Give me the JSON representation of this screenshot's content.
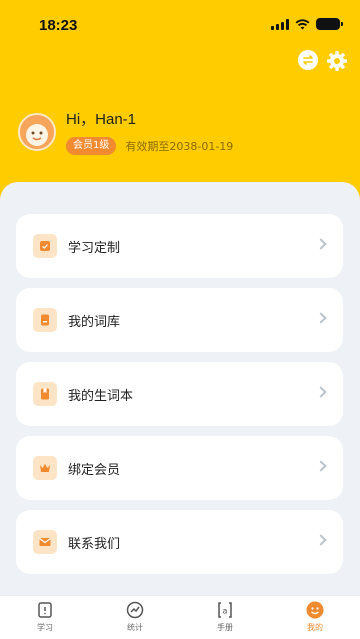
{
  "status_bar": {
    "time": "18:23"
  },
  "profile": {
    "greeting": "Hi，Han-1",
    "member_badge": "会员1级",
    "validity": "有效期至2038-01-19"
  },
  "menu": [
    {
      "label": "学习定制",
      "icon": "customize-icon"
    },
    {
      "label": "我的词库",
      "icon": "wordbook-icon"
    },
    {
      "label": "我的生词本",
      "icon": "notebook-icon"
    },
    {
      "label": "绑定会员",
      "icon": "crown-icon"
    },
    {
      "label": "联系我们",
      "icon": "mail-icon"
    }
  ],
  "tabs": [
    {
      "label": "学习",
      "icon": "study-icon",
      "active": false
    },
    {
      "label": "统计",
      "icon": "stats-icon",
      "active": false
    },
    {
      "label": "手册",
      "icon": "handbook-icon",
      "active": false
    },
    {
      "label": "我的",
      "icon": "profile-smile-icon",
      "active": true
    }
  ],
  "colors": {
    "accent": "#ffcc00",
    "orange": "#f28a2f",
    "background": "#eef2f7"
  }
}
